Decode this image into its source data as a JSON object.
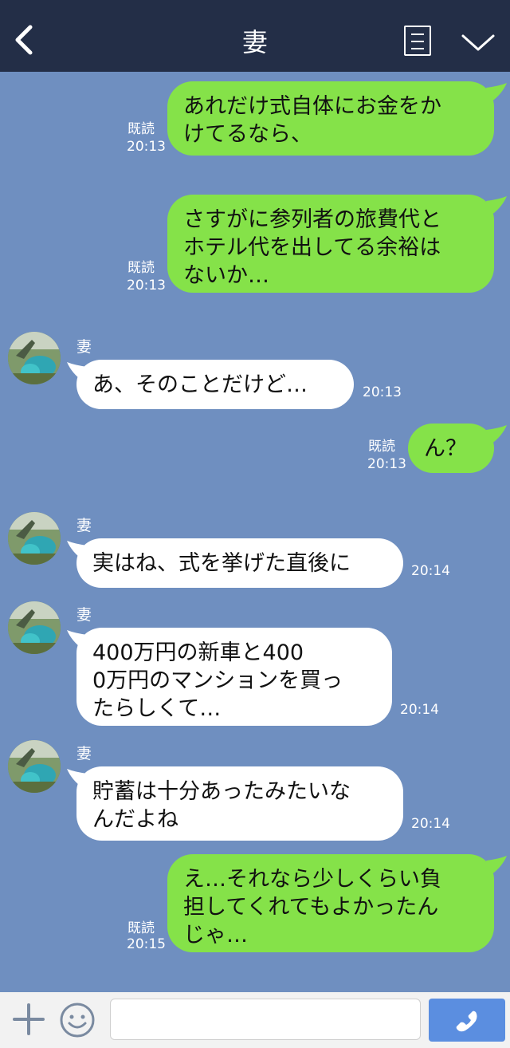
{
  "header": {
    "title": "妻"
  },
  "messages": [
    {
      "side": "right",
      "text": "あれだけ式自体にお金をか\nけてるなら、",
      "read": "既読",
      "time": "20:13"
    },
    {
      "side": "right",
      "text": "さすがに参列者の旅費代と\nホテル代を出してる余裕は\nないか…",
      "read": "既読",
      "time": "20:13"
    },
    {
      "side": "left",
      "sender": "妻",
      "text": "あ、そのことだけど…",
      "time": "20:13"
    },
    {
      "side": "right",
      "text": "ん？",
      "read": "既読",
      "time": "20:13"
    },
    {
      "side": "left",
      "sender": "妻",
      "text": "実はね、式を挙げた直後に",
      "time": "20:14"
    },
    {
      "side": "left",
      "sender": "妻",
      "text": "400万円の新車と400\n0万円のマンションを買っ\nたらしくて…",
      "time": "20:14"
    },
    {
      "side": "left",
      "sender": "妻",
      "text": "貯蓄は十分あったみたいな\nんだよね",
      "time": "20:14"
    },
    {
      "side": "right",
      "text": "え…それなら少しくらい負\n担してくれてもよかったん\nじゃ…",
      "read": "既読",
      "time": "20:15"
    }
  ],
  "input": {
    "value": ""
  },
  "colors": {
    "header": "#232e47",
    "chat_bg": "#6f8fc0",
    "green_bubble": "#85e249",
    "white_bubble": "#ffffff",
    "call_button": "#5b8ee0"
  }
}
